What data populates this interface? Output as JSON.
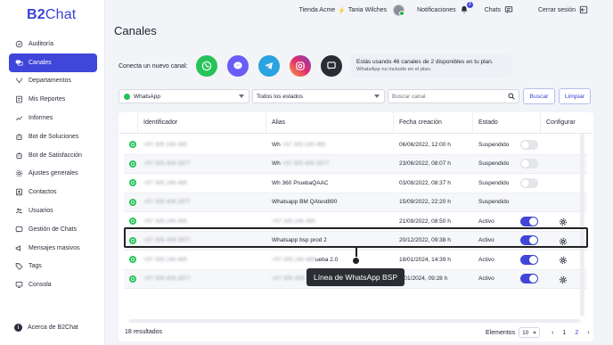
{
  "app": {
    "logo_bold": "B2",
    "logo_rest": "Chat"
  },
  "sidebar": {
    "items": [
      {
        "label": "Auditoría",
        "icon": "check-circle-icon",
        "active": false
      },
      {
        "label": "Canales",
        "icon": "chat-bubbles-icon",
        "active": true
      },
      {
        "label": "Departamentos",
        "icon": "branch-icon",
        "active": false
      },
      {
        "label": "Mis Reportes",
        "icon": "report-icon",
        "active": false
      },
      {
        "label": "Informes",
        "icon": "trend-icon",
        "active": false
      },
      {
        "label": "Bot de Soluciones",
        "icon": "bot-icon",
        "active": false
      },
      {
        "label": "Bot de Satisfacción",
        "icon": "bot-icon",
        "active": false
      },
      {
        "label": "Ajustes generales",
        "icon": "gear-icon",
        "active": false
      },
      {
        "label": "Contactos",
        "icon": "contacts-icon",
        "active": false
      },
      {
        "label": "Usuarios",
        "icon": "users-icon",
        "active": false
      },
      {
        "label": "Gestión de Chats",
        "icon": "chats-icon",
        "active": false
      },
      {
        "label": "Mensajes masivos",
        "icon": "megaphone-icon",
        "active": false
      },
      {
        "label": "Tags",
        "icon": "tag-icon",
        "active": false
      },
      {
        "label": "Consola",
        "icon": "monitor-icon",
        "active": false
      }
    ],
    "footer": "Acerca de B2Chat"
  },
  "topbar": {
    "store": "Tienda Acme",
    "user": "Tania Wilches",
    "notifications": "Notificaciones",
    "notifications_count": "3",
    "chats": "Chats",
    "logout": "Cerrar sesión"
  },
  "header": {
    "title": "Canales",
    "connect_label": "Conecta un nuevo canal:",
    "channels": [
      "whatsapp-icon",
      "messenger-icon",
      "telegram-icon",
      "instagram-icon",
      "livechat-icon"
    ],
    "info_main": "Estás usando 46 canales de 2 disponibles en tu plan.",
    "info_sub": "WhatsApp no incluido en el plan."
  },
  "filters": {
    "channel": "WhatsApp",
    "state": "Todos los estados",
    "search_placeholder": "Buscar canal",
    "search_button": "Buscar",
    "clear_button": "Limpiar"
  },
  "table": {
    "headers": [
      "Identificador",
      "Alias",
      "Fecha creación",
      "Estado",
      "Configurar"
    ],
    "rows": [
      {
        "id": "+57 305 245 495",
        "alias_prefix": "Wh",
        "alias_blur": "+57 305 245 495",
        "alias_suffix": "",
        "date": "06/06/2022, 12:00 h",
        "state": "Suspendido",
        "on": false,
        "config": false
      },
      {
        "id": "+57 305 409 2877",
        "alias_prefix": "Wh",
        "alias_blur": "+57 305 409 2877",
        "alias_suffix": "",
        "date": "23/06/2022, 08:07 h",
        "state": "Suspendido",
        "on": false,
        "config": false
      },
      {
        "id": "+57 305 245 495",
        "alias_prefix": "Wh 360 PruebaQAAC",
        "alias_blur": "",
        "alias_suffix": "",
        "date": "03/08/2022, 08:37 h",
        "state": "Suspendido",
        "on": false,
        "config": false
      },
      {
        "id": "+57 305 409 2877",
        "alias_prefix": "Whatsapp BM QAtest890",
        "alias_blur": "",
        "alias_suffix": "",
        "date": "15/09/2022, 22:20 h",
        "state": "Suspendido",
        "on": null,
        "config": false
      },
      {
        "id": "+57 305 245 495",
        "alias_prefix": "",
        "alias_blur": "+57 305 245 495",
        "alias_suffix": "",
        "date": "21/09/2022, 08:50 h",
        "state": "Activo",
        "on": true,
        "config": true
      },
      {
        "id": "+57 305 409 2877",
        "alias_prefix": "Whatsapp bsp prod 2",
        "alias_blur": "",
        "alias_suffix": "",
        "date": "20/12/2022, 09:38 h",
        "state": "Activo",
        "on": true,
        "config": true
      },
      {
        "id": "+57 305 245 495",
        "alias_prefix": "",
        "alias_blur": "+57 305 245 495",
        "alias_suffix": "ueba 2.0",
        "date": "18/01/2024, 14:39 h",
        "state": "Activo",
        "on": true,
        "config": true
      },
      {
        "id": "+57 305 409 2877",
        "alias_prefix": "",
        "alias_blur": "+57 305 409 2877",
        "alias_suffix": "",
        "date": "8/01/2024, 09:28 h",
        "state": "Activo",
        "on": true,
        "config": true
      }
    ]
  },
  "tooltip": "Línea de WhatsApp BSP",
  "footer": {
    "results": "18 resultados",
    "per_page_label": "Elementos",
    "per_page": "10",
    "pages": [
      "1",
      "2"
    ],
    "prev": "‹",
    "next": "›"
  },
  "colors": {
    "accent": "#4046d9",
    "whatsapp": "#25c35a"
  }
}
